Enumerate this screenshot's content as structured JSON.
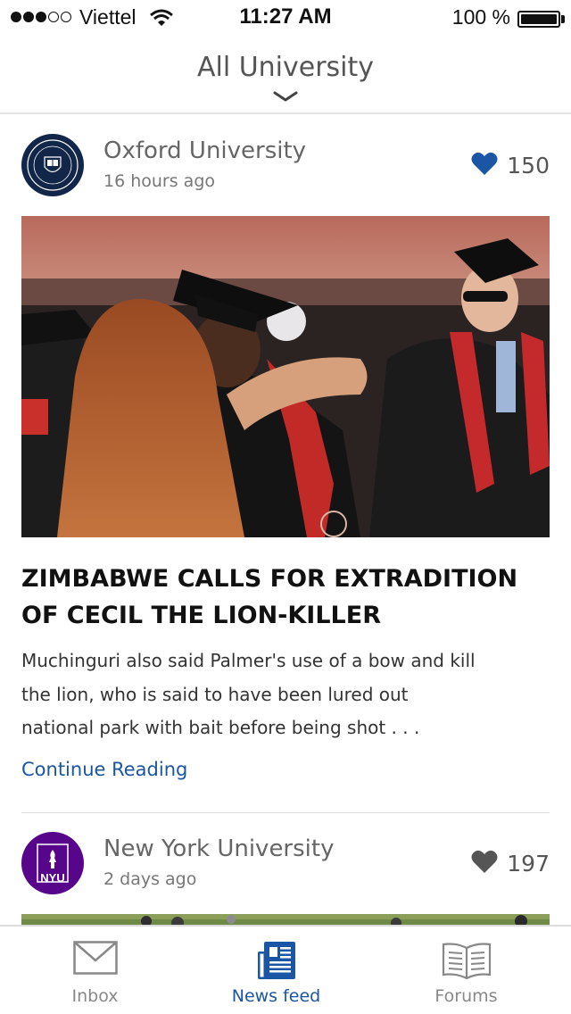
{
  "status_bar": {
    "carrier": "Viettel",
    "time": "11:27 AM",
    "battery": "100 %",
    "signal_bars": 3
  },
  "header": {
    "title": "All University"
  },
  "posts": [
    {
      "university": "Oxford University",
      "time_ago": "16 hours ago",
      "likes": "150",
      "liked": true,
      "title": "ZIMBABWE CALLS FOR EXTRADITION OF CECIL THE LION-KILLER",
      "excerpt": "Muchinguri also said Palmer's use of a bow and kill the lion, who is said to have been lured out national park with bait before being shot . . .",
      "continue_label": "Continue Reading"
    },
    {
      "university": "New York University",
      "time_ago": "2 days ago",
      "likes": "197",
      "liked": false,
      "avatar_text": "NYU"
    }
  ],
  "tabbar": {
    "tabs": [
      {
        "label": "Inbox",
        "icon": "inbox-icon",
        "active": false
      },
      {
        "label": "News feed",
        "icon": "newsfeed-icon",
        "active": true
      },
      {
        "label": "Forums",
        "icon": "forums-icon",
        "active": false
      }
    ]
  },
  "colors": {
    "accent": "#1a56a4",
    "heart_liked": "#1a56a4",
    "heart_unliked": "#555555",
    "oxford_blue": "#12264a",
    "nyu_purple": "#57068c"
  }
}
